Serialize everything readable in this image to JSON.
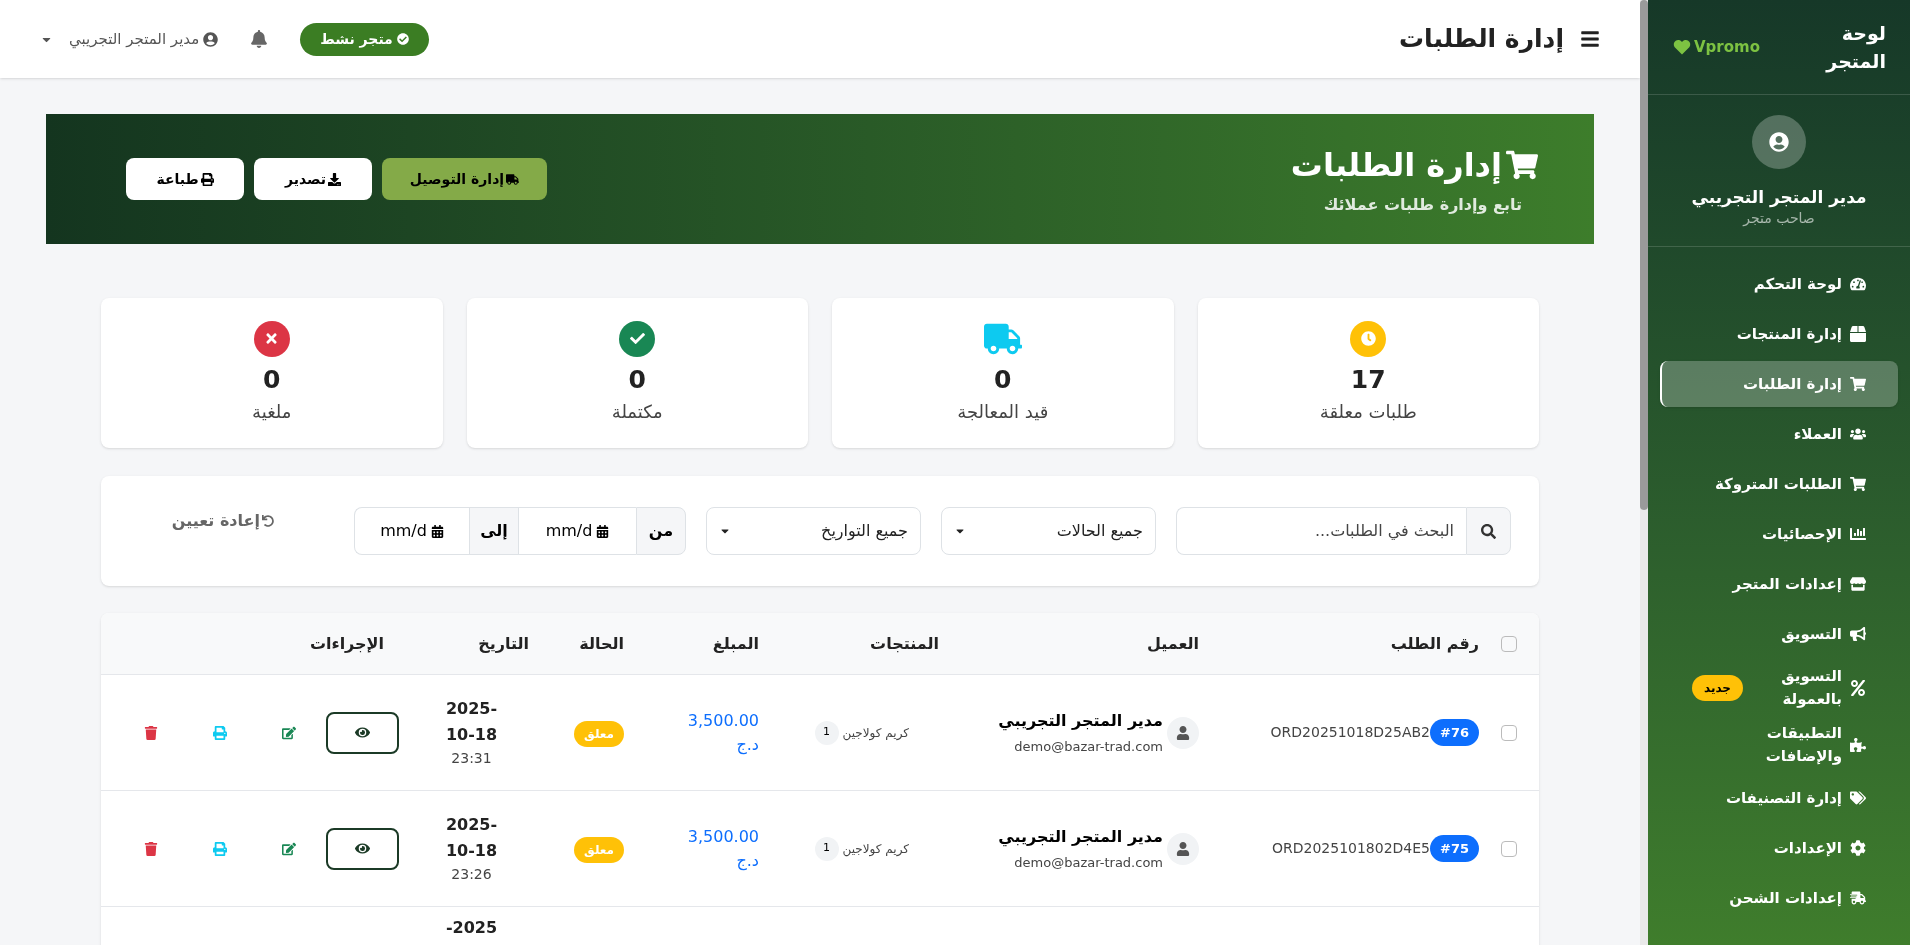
{
  "sidebar": {
    "logo": "Vpromo",
    "brand": "لوحة المتجر",
    "profile": {
      "name": "مدير المتجر التجريبي",
      "role": "صاحب متجر"
    },
    "items": [
      {
        "label": "لوحة التحكم",
        "selected": false
      },
      {
        "label": "إدارة المنتجات",
        "selected": false
      },
      {
        "label": "إدارة الطلبات",
        "selected": true
      },
      {
        "label": "العملاء",
        "selected": false
      },
      {
        "label": "الطلبات المتروكة",
        "selected": false
      },
      {
        "label": "الإحصائيات",
        "selected": false
      },
      {
        "label": "إعدادات المتجر",
        "selected": false
      },
      {
        "label": "التسويق",
        "selected": false
      },
      {
        "label": "التسويق بالعمولة",
        "selected": false,
        "badge": "جديد"
      },
      {
        "label": "التطبيقات والإضافات",
        "selected": false
      },
      {
        "label": "إدارة التصنيفات",
        "selected": false
      },
      {
        "label": "الإعدادات",
        "selected": false
      },
      {
        "label": "إعدادات الشحن",
        "selected": false
      }
    ]
  },
  "topbar": {
    "title": "إدارة الطلبات",
    "store_status": "متجر نشط",
    "user": "مدير المتجر التجريبي"
  },
  "banner": {
    "title": "إدارة الطلبات",
    "subtitle": "تابع وإدارة طلبات عملائك",
    "buttons": [
      {
        "label": "إدارة التوصيل",
        "kind": "primary"
      },
      {
        "label": "تصدير",
        "kind": "light"
      },
      {
        "label": "طباعة",
        "kind": "light"
      }
    ]
  },
  "stats": [
    {
      "value": "17",
      "label": "طلبات معلقة",
      "color": "#ffc107"
    },
    {
      "value": "0",
      "label": "قيد المعالجة",
      "color": "#0dcaf0"
    },
    {
      "value": "0",
      "label": "مكتملة",
      "color": "#198754"
    },
    {
      "value": "0",
      "label": "ملغية",
      "color": "#dc3545"
    }
  ],
  "filters": {
    "search": {
      "placeholder": "البحث في الطلبات..."
    },
    "status_select": "جميع الحالات",
    "date_select": "جميع التواريخ",
    "from_label": "من",
    "from_date": "mm/d",
    "to_label": "إلى",
    "to_date": "mm/d",
    "reset": "إعادة تعيين"
  },
  "table": {
    "select_all": {
      "checked": false
    },
    "columns": [
      "رقم الطلب",
      "العميل",
      "المنتجات",
      "المبلغ",
      "الحالة",
      "التاريخ",
      "الإجراءات"
    ],
    "rows": [
      {
        "checked": false,
        "id": "#76",
        "number": "ORD20251018D25AB2",
        "customer": "مدير المتجر التجريبي",
        "email": "demo@bazar-trad.com",
        "product": "كريم كولاجين",
        "qty": "1",
        "amount": "3,500.00",
        "currency": "د.ج",
        "status": {
          "label": "معلق",
          "color": "#ffc107"
        },
        "date": "2025-10-18",
        "time": "23:31"
      },
      {
        "checked": false,
        "id": "#75",
        "number": "ORD2025101802D4E5",
        "customer": "مدير المتجر التجريبي",
        "email": "demo@bazar-trad.com",
        "product": "كريم كولاجين",
        "qty": "1",
        "amount": "3,500.00",
        "currency": "د.ج",
        "status": {
          "label": "معلق",
          "color": "#ffc107"
        },
        "date": "2025-10-18",
        "time": "23:26"
      },
      {
        "date": "2025-"
      }
    ]
  }
}
